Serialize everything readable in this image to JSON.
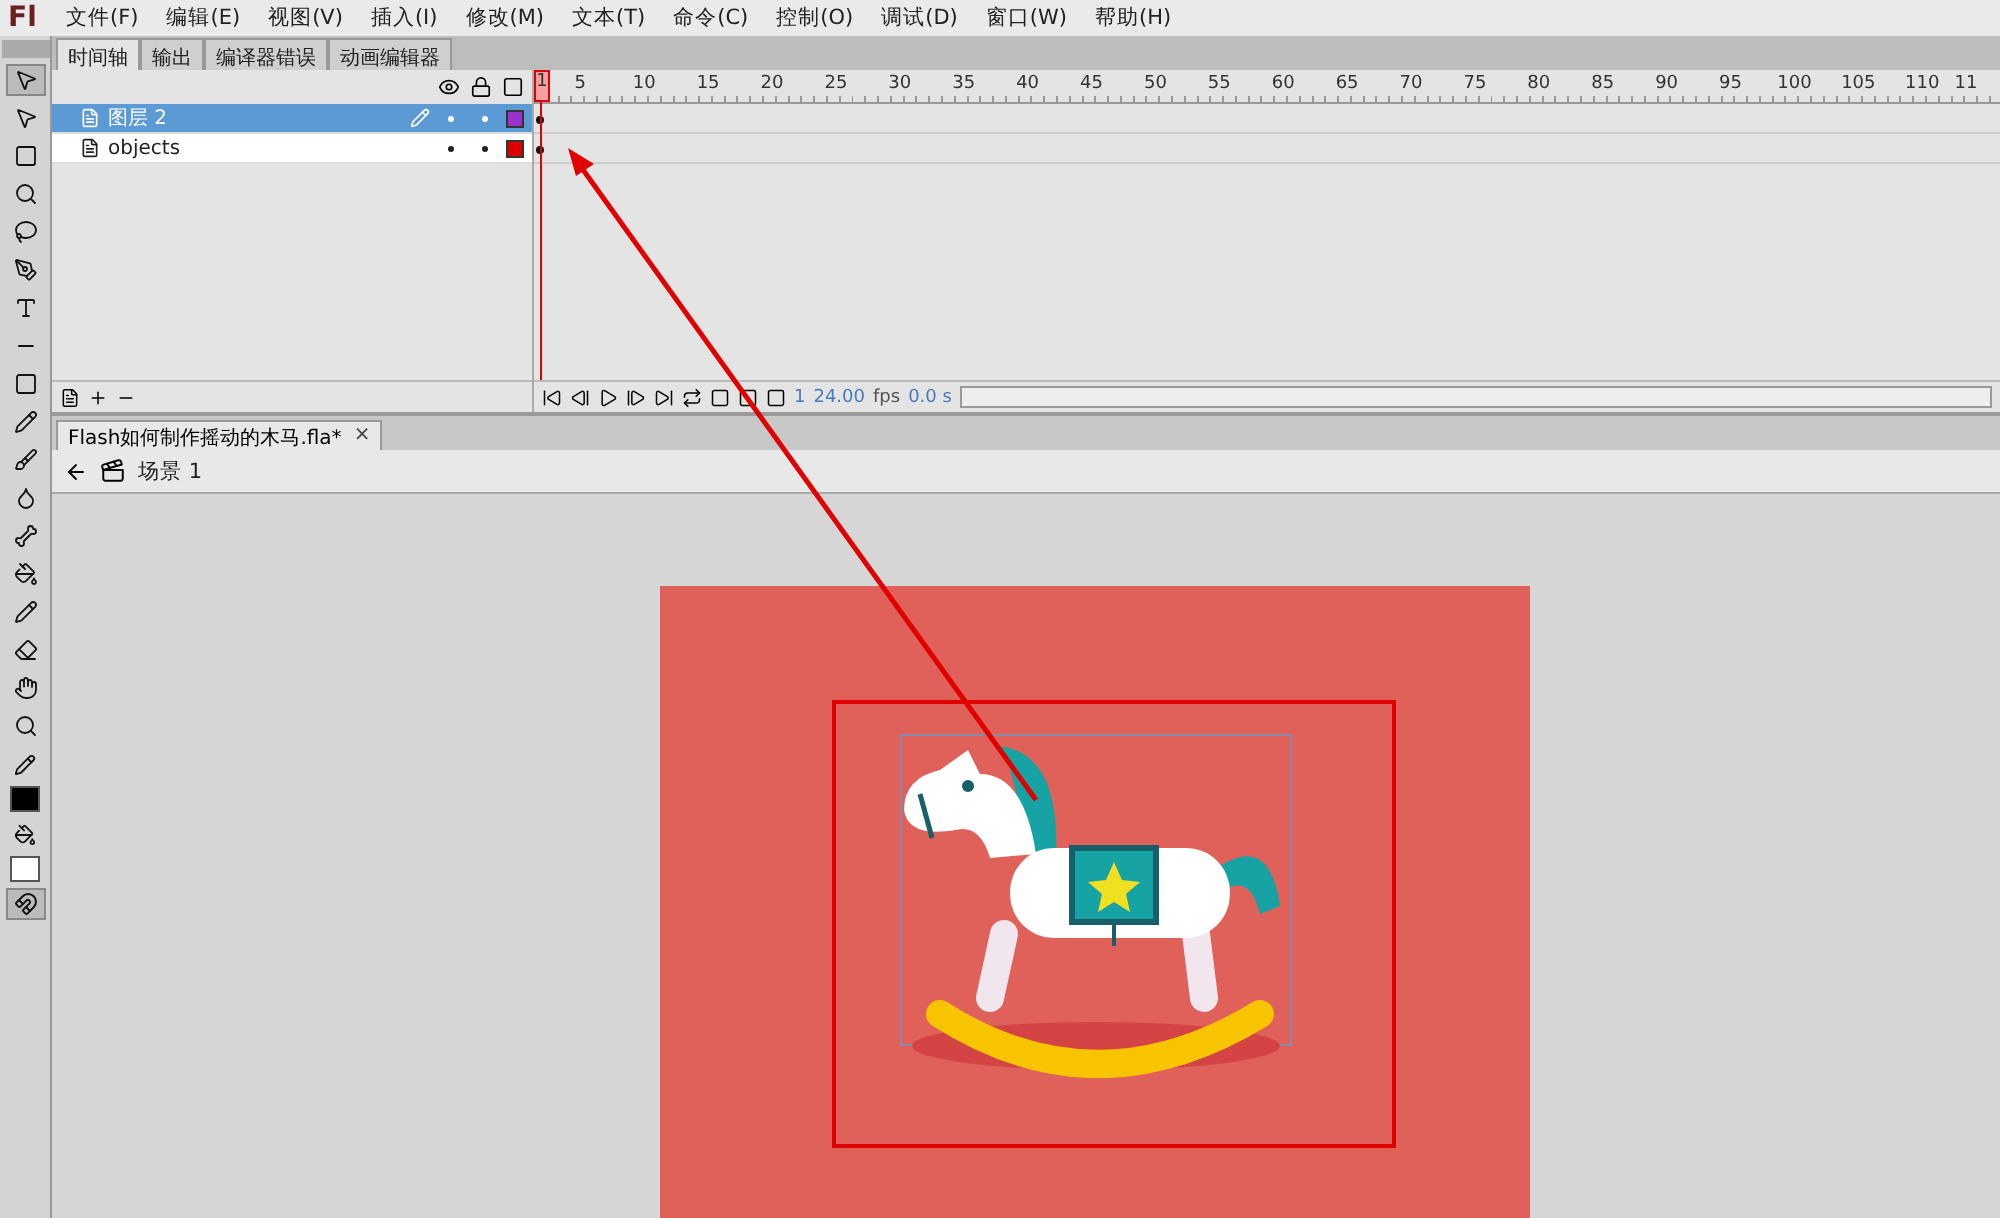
{
  "app_logo": "Fl",
  "menu": [
    "文件(F)",
    "编辑(E)",
    "视图(V)",
    "插入(I)",
    "修改(M)",
    "文本(T)",
    "命令(C)",
    "控制(O)",
    "调试(D)",
    "窗口(W)",
    "帮助(H)"
  ],
  "panel_tabs": [
    {
      "label": "时间轴",
      "selected": true
    },
    {
      "label": "输出",
      "selected": false
    },
    {
      "label": "编译器错误",
      "selected": false
    },
    {
      "label": "动画编辑器",
      "selected": false
    }
  ],
  "timeline": {
    "playhead": "1",
    "ruler": [
      "5",
      "10",
      "15",
      "20",
      "25",
      "30",
      "35",
      "40",
      "45",
      "50",
      "55",
      "60",
      "65",
      "70",
      "75",
      "80",
      "85",
      "90",
      "95",
      "100",
      "105",
      "110",
      "11"
    ],
    "layers": [
      {
        "name": "图层 2",
        "selected": true,
        "color": "#9933cc"
      },
      {
        "name": "objects",
        "selected": false,
        "color": "#dd0000"
      }
    ],
    "frame": "1",
    "fps": "24.00",
    "fps_unit": "fps",
    "time": "0.0 s"
  },
  "document_tab": "Flash如何制作摇动的木马.fla*",
  "close_mark": "×",
  "scene": "场景 1"
}
